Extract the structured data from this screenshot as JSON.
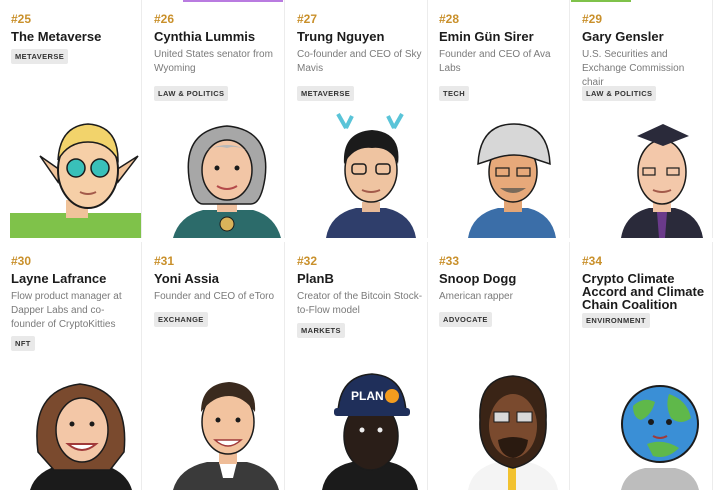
{
  "accent_color": "#c9902b",
  "cards": [
    {
      "rank": "#25",
      "name": "The Metaverse",
      "description": "",
      "tag": "METAVERSE",
      "avatar": "elf-avatar-icon"
    },
    {
      "rank": "#26",
      "name": "Cynthia Lummis",
      "description": "United States senator from Wyoming",
      "tag": "LAW & POLITICS",
      "avatar": "senator-avatar-icon"
    },
    {
      "rank": "#27",
      "name": "Trung Nguyen",
      "description": "Co-founder and CEO of Sky Mavis",
      "tag": "METAVERSE",
      "avatar": "antler-avatar-icon"
    },
    {
      "rank": "#28",
      "name": "Emin Gün Sirer",
      "description": "Founder and CEO of Ava Labs",
      "tag": "TECH",
      "avatar": "foil-hat-avatar-icon"
    },
    {
      "rank": "#29",
      "name": "Gary Gensler",
      "description": "U.S. Securities and Exchange Commission chair",
      "tag": "LAW & POLITICS",
      "avatar": "graduate-avatar-icon"
    },
    {
      "rank": "#30",
      "name": "Layne Lafrance",
      "description": "Flow product manager at Dapper Labs and co-founder of CryptoKitties",
      "tag": "NFT",
      "avatar": "smiling-woman-avatar-icon"
    },
    {
      "rank": "#31",
      "name": "Yoni Assia",
      "description": "Founder and CEO of eToro",
      "tag": "EXCHANGE",
      "avatar": "suit-man-avatar-icon"
    },
    {
      "rank": "#32",
      "name": "PlanB",
      "description": "Creator of the Bitcoin Stock-to-Flow model",
      "tag": "MARKETS",
      "avatar": "planb-cap-avatar-icon",
      "cap_text": "PLAN"
    },
    {
      "rank": "#33",
      "name": "Snoop Dogg",
      "description": "American rapper",
      "tag": "ADVOCATE",
      "avatar": "rapper-avatar-icon"
    },
    {
      "rank": "#34",
      "name": "Crypto Climate Accord and Climate Chain Coalition",
      "description": "",
      "tag": "ENVIRONMENT",
      "avatar": "earth-head-avatar-icon"
    }
  ]
}
